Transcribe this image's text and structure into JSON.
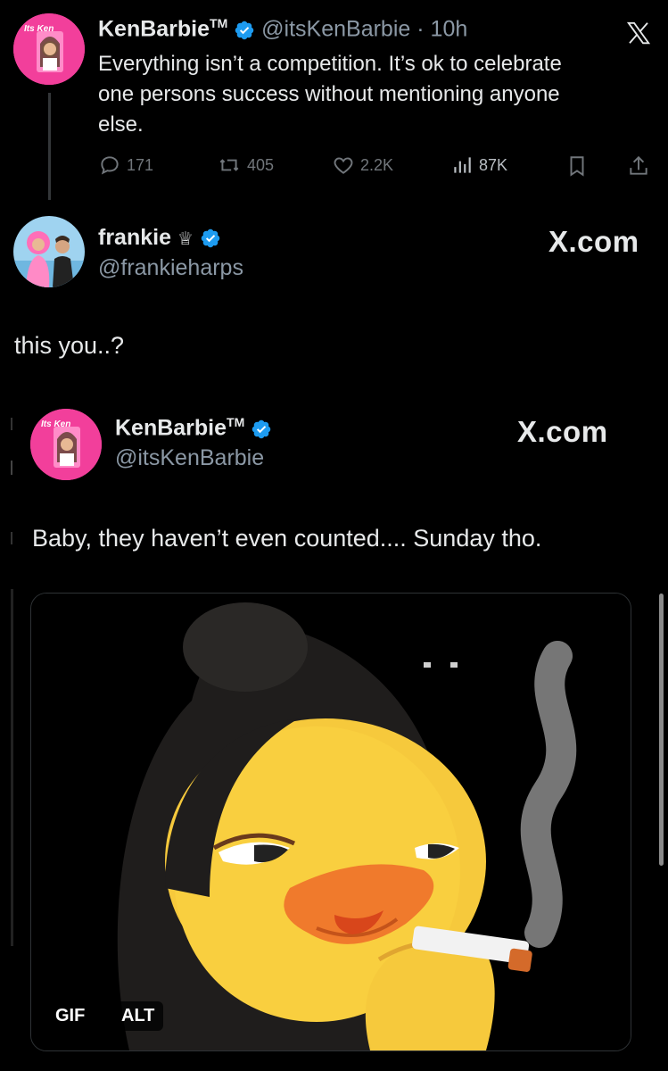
{
  "tweet1": {
    "display_name": "KenBarbie",
    "tm": "TM",
    "handle": "@itsKenBarbie",
    "separator": "·",
    "time": "10h",
    "text_line1": "Everything isn’t a competition. It’s ok to celebrate",
    "text_line2": "one persons success without mentioning anyone",
    "text_line3": "else.",
    "avatar_text": "Its Ken",
    "metrics": {
      "replies": "171",
      "retweets": "405",
      "likes": "2.2K",
      "views": "87K"
    }
  },
  "tweet2": {
    "display_name": "frankie",
    "crown": "♕",
    "handle": "@frankieharps",
    "source": "X.com",
    "text": "this you..?"
  },
  "quoted": {
    "display_name": "KenBarbie",
    "tm": "TM",
    "handle": "@itsKenBarbie",
    "source": "X.com",
    "avatar_text": "Its Ken",
    "text": "Baby, they haven’t even counted.... Sunday tho.",
    "media": {
      "gif_label": "GIF",
      "alt_label": "ALT"
    }
  },
  "colors": {
    "background": "#000000",
    "verified": "#1d9bf0",
    "muted": "#71767b",
    "avatar_pink": "#f23f9b"
  }
}
